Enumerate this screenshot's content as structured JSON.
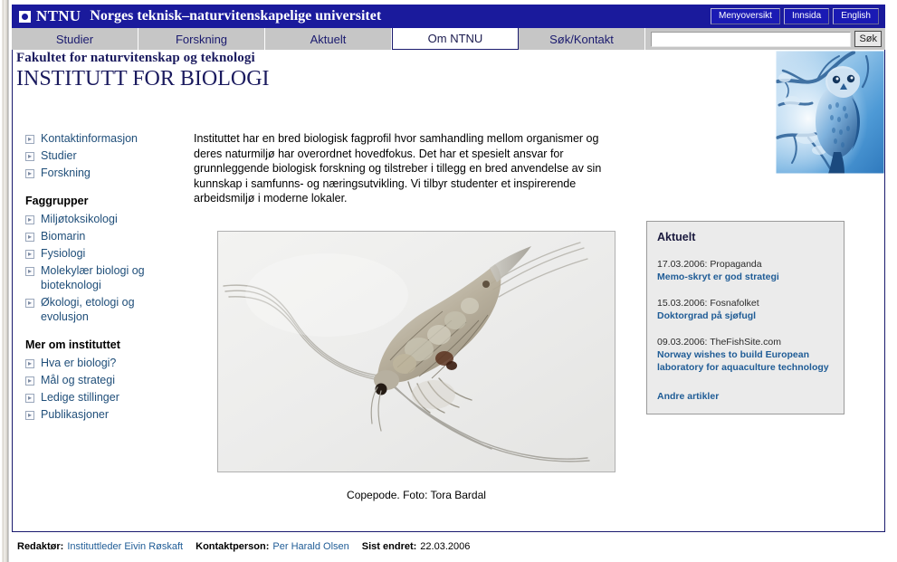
{
  "topbar": {
    "logo_icon": "ntnu-square-dot-icon",
    "brand": "NTNU",
    "site_title": "Norges teknisk–naturvitenskapelige universitet",
    "links": [
      {
        "label": "Menyoversikt"
      },
      {
        "label": "Innsida"
      },
      {
        "label": "English"
      }
    ]
  },
  "tabs": [
    {
      "label": "Studier",
      "active": false
    },
    {
      "label": "Forskning",
      "active": false
    },
    {
      "label": "Aktuelt",
      "active": false
    },
    {
      "label": "Om NTNU",
      "active": true
    },
    {
      "label": "Søk/Kontakt",
      "active": false
    }
  ],
  "search": {
    "value": "",
    "placeholder": "",
    "button_label": "Søk"
  },
  "heading": {
    "faculty": "Fakultet for naturvitenskap og teknologi",
    "institute": "INSTITUTT FOR BIOLOGI"
  },
  "banner": {
    "icon": "owl-on-branch-photo",
    "alt": "Ugle i vintertre"
  },
  "sidebar": {
    "top_items": [
      {
        "label": "Kontaktinformasjon"
      },
      {
        "label": "Studier"
      },
      {
        "label": "Forskning"
      }
    ],
    "group1_title": "Faggrupper",
    "group1_items": [
      {
        "label": "Miljøtoksikologi"
      },
      {
        "label": "Biomarin"
      },
      {
        "label": "Fysiologi"
      },
      {
        "label": "Molekylær biologi og bioteknologi"
      },
      {
        "label": "Økologi, etologi og evolusjon"
      }
    ],
    "group2_title": "Mer om instituttet",
    "group2_items": [
      {
        "label": "Hva er biologi?"
      },
      {
        "label": "Mål og strategi"
      },
      {
        "label": "Ledige stillinger"
      },
      {
        "label": "Publikasjoner"
      }
    ]
  },
  "main": {
    "intro": "Instituttet har en bred biologisk fagprofil hvor samhandling mellom organismer og deres naturmiljø har overordnet hovedfokus. Det har et spesielt ansvar for grunnleggende biologisk forskning og tilstreber i tillegg en bred anvendelse av sin kunnskap i samfunns- og næringsutvikling. Vi tilbyr studenter et inspirerende arbeidsmiljø i moderne lokaler.",
    "photo_icon": "copepod-microscope-photo",
    "caption": "Copepode. Foto: Tora Bardal"
  },
  "aktuelt": {
    "title": "Aktuelt",
    "items": [
      {
        "date": "17.03.2006: Propaganda",
        "headline": "Memo-skryt er god strategi"
      },
      {
        "date": "15.03.2006: Fosnafolket",
        "headline": "Doktorgrad på sjøfugl"
      },
      {
        "date": "09.03.2006: TheFishSite.com",
        "headline": "Norway wishes to build European laboratory for aquaculture technology"
      }
    ],
    "more_label": "Andre artikler"
  },
  "footer": {
    "editor_label": "Redaktør:",
    "editor_value": "Instituttleder Eivin Røskaft",
    "contact_label": "Kontaktperson:",
    "contact_value": "Per Harald Olsen",
    "modified_label": "Sist endret:",
    "modified_value": "22.03.2006"
  },
  "colors": {
    "brand_blue": "#1a1a9c",
    "navy_text": "#1a1a5e",
    "link_blue": "#1f4e79",
    "news_link": "#1f5c96",
    "tab_grey": "#c6c6c6",
    "panel_grey": "#ebebeb"
  }
}
